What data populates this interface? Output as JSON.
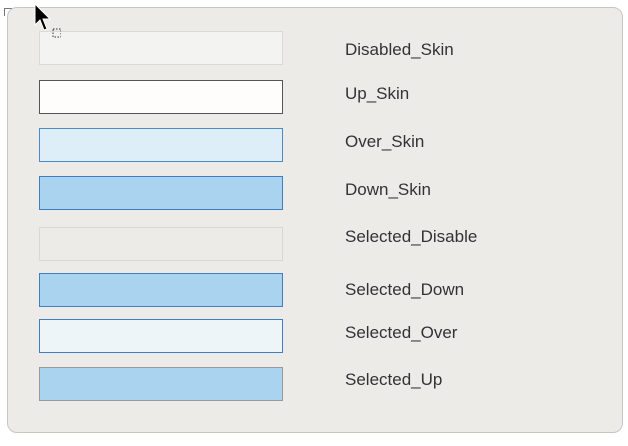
{
  "window": {
    "cursor_icon": "arrow-cursor-icon",
    "selection_marker_icon": "dotted-selection-icon"
  },
  "skins": [
    {
      "label": "Disabled_Skin",
      "fill": "#f3f3f2",
      "border": "#d9d9d6"
    },
    {
      "label": "Up_Skin",
      "fill": "#fefdfb",
      "border": "#555555"
    },
    {
      "label": "Over_Skin",
      "fill": "#ddeef8",
      "border": "#4a8ac5"
    },
    {
      "label": "Down_Skin",
      "fill": "#a9d3ee",
      "border": "#3f7fbf"
    },
    {
      "label": "Selected_Disable",
      "fill": "#ecebe7",
      "border": "#d8d7d3"
    },
    {
      "label": "Selected_Down",
      "fill": "#a9d3ee",
      "border": "#3f7fbf"
    },
    {
      "label": "Selected_Over",
      "fill": "#eef5f8",
      "border": "#3f7fbf"
    },
    {
      "label": "Selected_Up",
      "fill": "#a9d3ee",
      "border": "#999999"
    }
  ]
}
